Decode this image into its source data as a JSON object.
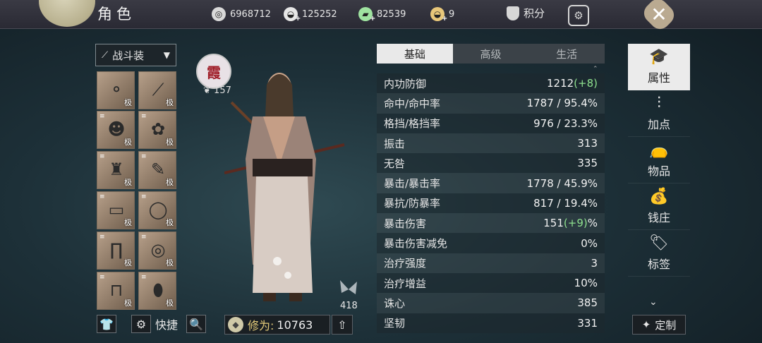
{
  "header": {
    "title": "角色"
  },
  "resources": [
    {
      "name": "coin-icon",
      "value": "6968712",
      "color": "#d9d9d9"
    },
    {
      "name": "silver-ingot-icon",
      "value": "125252",
      "color": "#e6e6e6"
    },
    {
      "name": "jade-ticket-icon",
      "value": "82539",
      "color": "#9fe3a0"
    },
    {
      "name": "gold-ingot-icon",
      "value": "9",
      "color": "#e8c77a"
    }
  ],
  "score_label": "积分",
  "outfit": {
    "label": "战斗装"
  },
  "grade_label": "极",
  "level": {
    "badge_text": "霞",
    "value": "157"
  },
  "pet_count": "418",
  "bottom": {
    "shortcut_label": "快捷",
    "cultivation_label": "修为:",
    "cultivation_value": "10763"
  },
  "tabs": [
    "基础",
    "高级",
    "生活"
  ],
  "stats": [
    {
      "label": "内功防御",
      "value": "1212",
      "bonus": "(+8)",
      "suffix": ""
    },
    {
      "label": "命中/命中率",
      "value": "1787 / 95.4%",
      "bonus": "",
      "suffix": ""
    },
    {
      "label": "格挡/格挡率",
      "value": "976 / 23.3%",
      "bonus": "",
      "suffix": ""
    },
    {
      "label": "振击",
      "value": "313",
      "bonus": "",
      "suffix": ""
    },
    {
      "label": "无咎",
      "value": "335",
      "bonus": "",
      "suffix": ""
    },
    {
      "label": "暴击/暴击率",
      "value": "1778 / 45.9%",
      "bonus": "",
      "suffix": ""
    },
    {
      "label": "暴抗/防暴率",
      "value": "817 / 19.4%",
      "bonus": "",
      "suffix": ""
    },
    {
      "label": "暴击伤害",
      "value": "151",
      "bonus": "(+9)",
      "suffix": "%"
    },
    {
      "label": "暴击伤害减免",
      "value": "0%",
      "bonus": "",
      "suffix": ""
    },
    {
      "label": "治疗强度",
      "value": "3",
      "bonus": "",
      "suffix": ""
    },
    {
      "label": "治疗增益",
      "value": "10%",
      "bonus": "",
      "suffix": ""
    },
    {
      "label": "诛心",
      "value": "385",
      "bonus": "",
      "suffix": ""
    },
    {
      "label": "坚韧",
      "value": "331",
      "bonus": "",
      "suffix": ""
    }
  ],
  "menu": [
    {
      "label": "属性",
      "icon": "scholar-hat-icon",
      "glyph": "🎓"
    },
    {
      "label": "加点",
      "icon": "sliders-icon",
      "glyph": "⫶"
    },
    {
      "label": "物品",
      "icon": "bag-icon",
      "glyph": "👝"
    },
    {
      "label": "钱庄",
      "icon": "money-bag-icon",
      "glyph": "💰"
    },
    {
      "label": "标签",
      "icon": "tag-icon",
      "glyph": "🏷"
    }
  ],
  "custom_label": "定制"
}
